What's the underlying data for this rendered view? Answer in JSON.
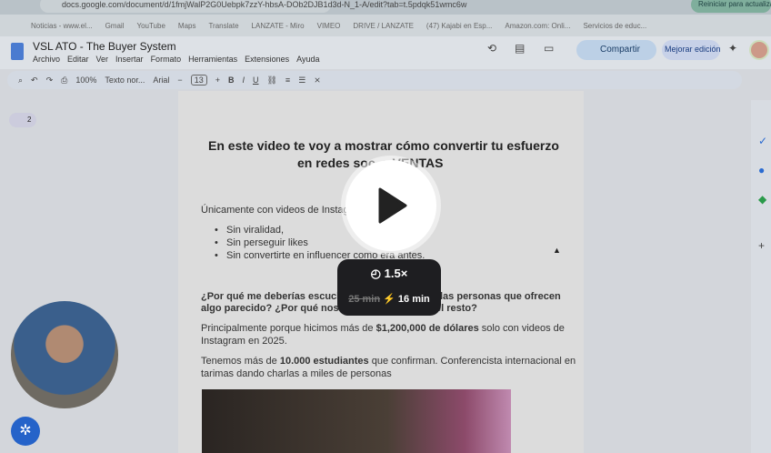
{
  "browser": {
    "url": "docs.google.com/document/d/1fmjWalP2G0Uebpk7zzY-hbsA-DOb2DJB1d3d-N_1-A/edit?tab=t.5pdqk51wmc6w",
    "restart": "Reiniciar para actualizar",
    "bookmarks": [
      "Noticias - www.el...",
      "Gmail",
      "YouTube",
      "Maps",
      "Translate",
      "LANZATE - Miro",
      "VIMEO",
      "DRIVE / LANZATE",
      "(47) Kajabi en Esp...",
      "Amazon.com: Onli...",
      "Servicios de educ..."
    ]
  },
  "doc": {
    "title": "VSL ATO - The Buyer System",
    "menus": [
      "Archivo",
      "Editar",
      "Ver",
      "Insertar",
      "Formato",
      "Herramientas",
      "Extensiones",
      "Ayuda"
    ],
    "share": "Compartir",
    "improve": "Mejorar edición",
    "toolbar": {
      "zoom": "100%",
      "style": "Texto nor...",
      "font": "Arial",
      "size": "13"
    },
    "outline_count": "2"
  },
  "content": {
    "heading1": "En este video te voy a mostrar cómo convertir tu esfuerzo",
    "heading2a": "en redes soc",
    "heading2b": "a VENTAS",
    "intro": "Únicamente con videos de Instagra",
    "bullets": [
      "Sin viralidad,",
      "Sin perseguir likes",
      "Sin convertirte en influencer como era antes."
    ],
    "q1a": "¿Por qué me deberías escuchar",
    "q1b": "las personas que ofrecen",
    "q2a": "algo parecido?  ¿Por qué nosot",
    "q2b": "el resto?",
    "p1_pre": "Principalmente porque hicimos más de ",
    "p1_bold": "$1,200,000 de dólares",
    "p1_post": " solo con videos de",
    "p1_line2": "Instagram en 2025.",
    "p2_pre": "Tenemos más de ",
    "p2_bold": "10.000 estudiantes",
    "p2_post": " que confirman. Conferencista internacional en",
    "p2_line2": "tarimas dando charlas a miles de personas"
  },
  "player": {
    "speed": "1.5×",
    "original_time": "25 min",
    "new_time": "16 min",
    "accent": "#f5b400"
  }
}
